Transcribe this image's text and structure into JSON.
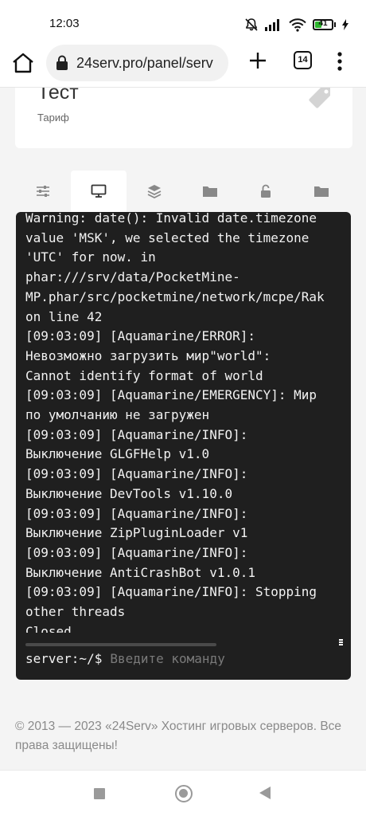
{
  "status_bar": {
    "time": "12:03",
    "battery_level": "41",
    "icons": [
      "mute-icon",
      "signal-icon",
      "wifi-icon",
      "battery-icon",
      "charging-icon"
    ]
  },
  "browser": {
    "url": "24serv.pro/panel/serv",
    "tabs_count": "14",
    "icons": [
      "home-icon",
      "lock-icon",
      "plus-icon",
      "tabs-icon",
      "menu-icon"
    ]
  },
  "plan_card": {
    "name": "Тест",
    "label": "Тариф",
    "icon": "tag-icon"
  },
  "tabs": [
    {
      "icon": "sliders-icon",
      "active": false
    },
    {
      "icon": "monitor-icon",
      "active": true
    },
    {
      "icon": "layers-icon",
      "active": false
    },
    {
      "icon": "folder-icon",
      "active": false
    },
    {
      "icon": "unlock-icon",
      "active": false
    },
    {
      "icon": "folder-icon",
      "active": false
    }
  ],
  "terminal": {
    "lines": [
      "Warning: date(): Invalid date.timezone",
      "value 'MSK', we selected the timezone",
      "'UTC' for now. in",
      "phar:///srv/data/PocketMine-",
      "MP.phar/src/pocketmine/network/mcpe/Rak",
      "on line 42",
      "[09:03:09] [Aquamarine/ERROR]:",
      "Невозможно загрузить мир\"world\":",
      "Cannot identify format of world",
      "[09:03:09] [Aquamarine/EMERGENCY]: Мир",
      "по умолчанию не загружен",
      "[09:03:09] [Aquamarine/INFO]:",
      "Выключение GLGFHelp v1.0",
      "[09:03:09] [Aquamarine/INFO]:",
      "Выключение DevTools v1.10.0",
      "[09:03:09] [Aquamarine/INFO]:",
      "Выключение ZipPluginLoader v1",
      "[09:03:09] [Aquamarine/INFO]:",
      "Выключение AntiCrashBot v1.0.1",
      "[09:03:09] [Aquamarine/INFO]: Stopping",
      "other threads",
      "Closed"
    ],
    "prompt": "server:~/$",
    "input_placeholder": "Введите команду",
    "input_value": ""
  },
  "footer": {
    "text": "© 2013 — 2023 «24Serv» Хостинг игровых серверов. Все права защищены!"
  },
  "nav_bar": {
    "icons": [
      "recents-icon",
      "home-icon",
      "back-icon"
    ]
  },
  "colors": {
    "terminal_bg": "#1f1f1f",
    "page_bg": "#f4f4f4",
    "tab_icon": "#888888",
    "battery": "#2db52d"
  }
}
